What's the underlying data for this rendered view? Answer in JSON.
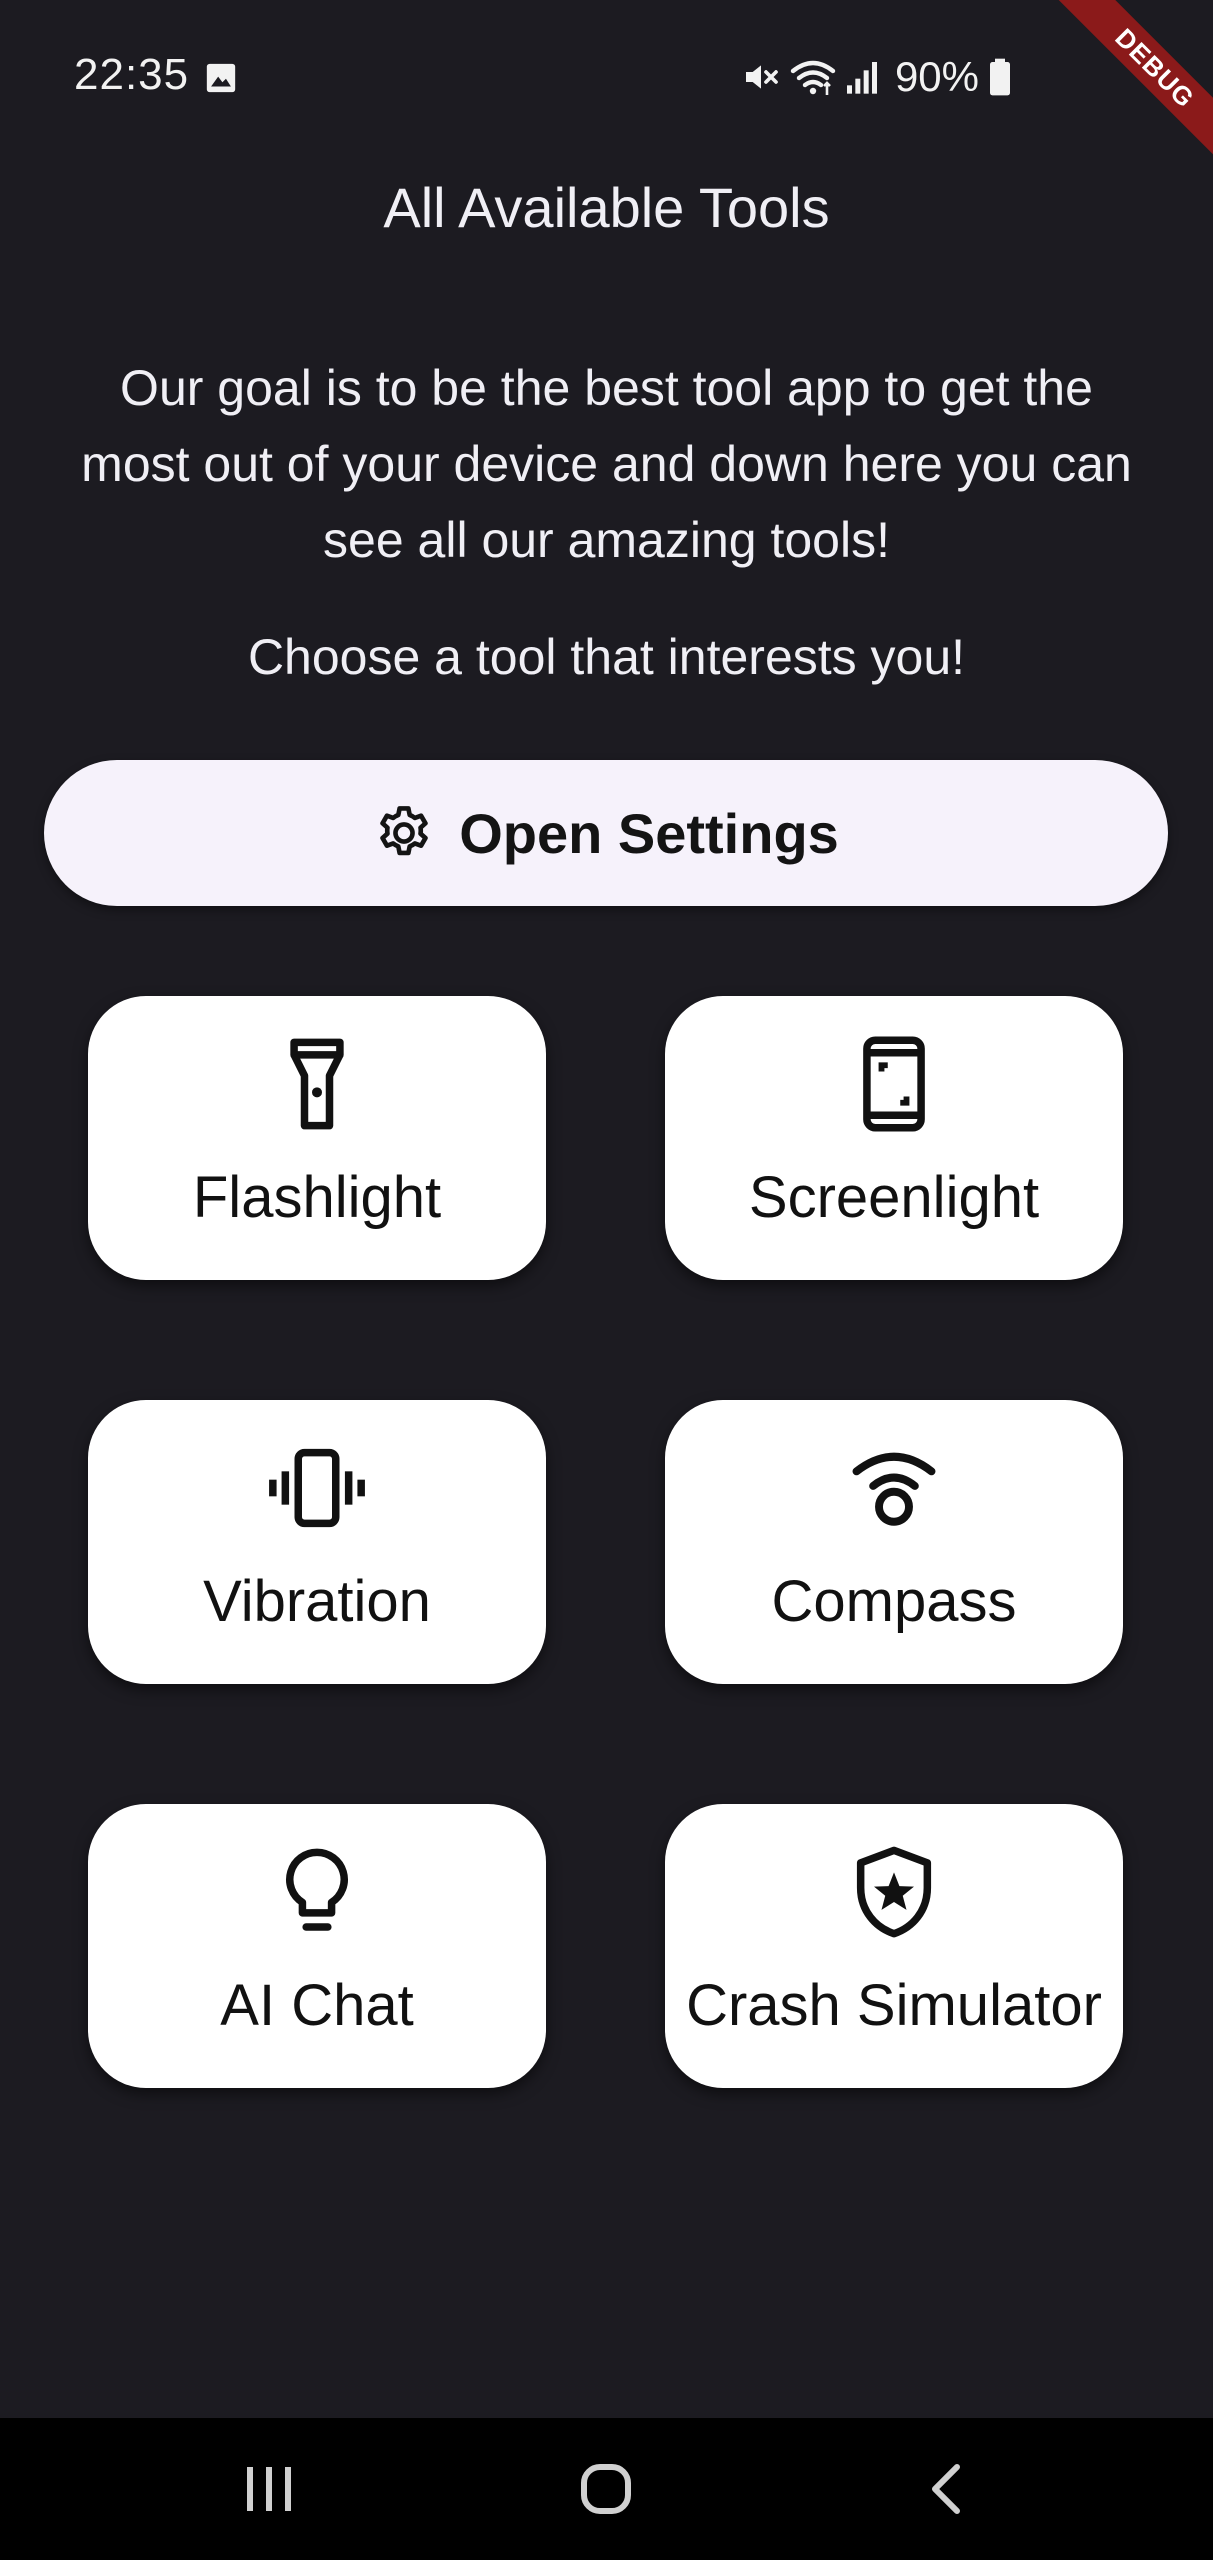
{
  "status_bar": {
    "time": "22:35",
    "battery_percent": "90%",
    "icons": [
      "gallery-icon",
      "mute-icon",
      "wifi-icon",
      "signal-icon",
      "battery-icon"
    ]
  },
  "debug_banner": "DEBUG",
  "page": {
    "title": "All Available Tools",
    "intro": "Our goal is to be the best tool app to get the most out of your device and down here you can see all our amazing tools!",
    "cta": "Choose a tool that interests you!"
  },
  "settings_button": {
    "label": "Open Settings",
    "icon": "gear-icon"
  },
  "tools": [
    {
      "label": "Flashlight",
      "icon": "flashlight-icon"
    },
    {
      "label": "Screenlight",
      "icon": "phone-icon"
    },
    {
      "label": "Vibration",
      "icon": "vibration-icon"
    },
    {
      "label": "Compass",
      "icon": "location-signal-icon"
    },
    {
      "label": "AI Chat",
      "icon": "lightbulb-icon"
    },
    {
      "label": "Crash Simulator",
      "icon": "shield-star-icon"
    }
  ],
  "nav_bar": {
    "buttons": [
      "recents-icon",
      "home-icon",
      "back-icon"
    ]
  },
  "colors": {
    "background": "#1c1b21",
    "card": "#ffffff",
    "settings_button": "#f6f2fb",
    "debug_ribbon": "#8b1a1a",
    "nav_bar": "#000000"
  }
}
